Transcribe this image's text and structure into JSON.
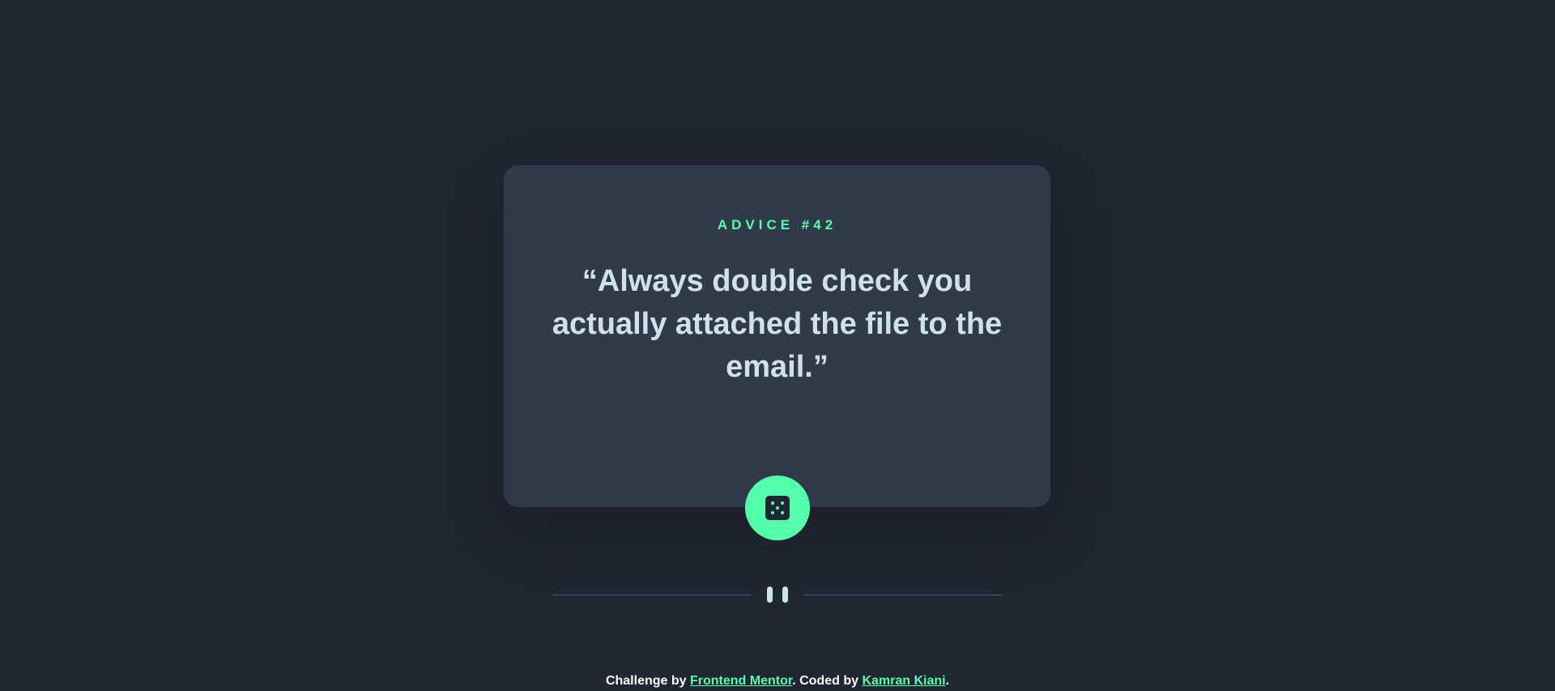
{
  "advice": {
    "label": "ADVICE #42",
    "text": "“Always double check you actually attached the file to the email.”"
  },
  "divider": {
    "icon": "pause-icon"
  },
  "action": {
    "icon": "dice-icon"
  },
  "footer": {
    "prefix": "Challenge by ",
    "challenge_link": "Frontend Mentor",
    "middle": ". Coded by ",
    "author_link": "Kamran Kiani",
    "suffix": "."
  },
  "colors": {
    "background": "#202632",
    "card": "#313a48",
    "accent": "#53ffab",
    "text": "#cee3e9"
  }
}
